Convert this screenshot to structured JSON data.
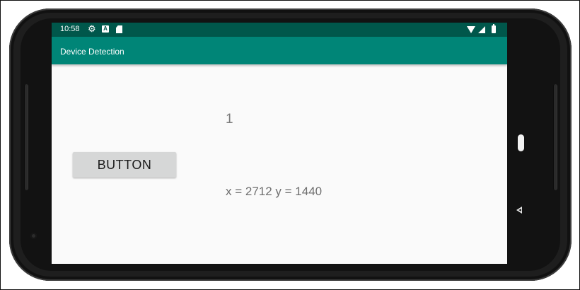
{
  "status_bar": {
    "time": "10:58",
    "icons": [
      "gear-icon",
      "a-icon",
      "sd-card-icon",
      "wifi-icon",
      "signal-icon",
      "battery-icon"
    ]
  },
  "app_bar": {
    "title": "Device Detection"
  },
  "main": {
    "button_label": "BUTTON",
    "count": "1",
    "coordinates": "x = 2712 y = 1440"
  },
  "colors": {
    "status_bar": "#00574b",
    "app_bar": "#008577",
    "background": "#fafafa",
    "button": "#d6d7d7"
  }
}
